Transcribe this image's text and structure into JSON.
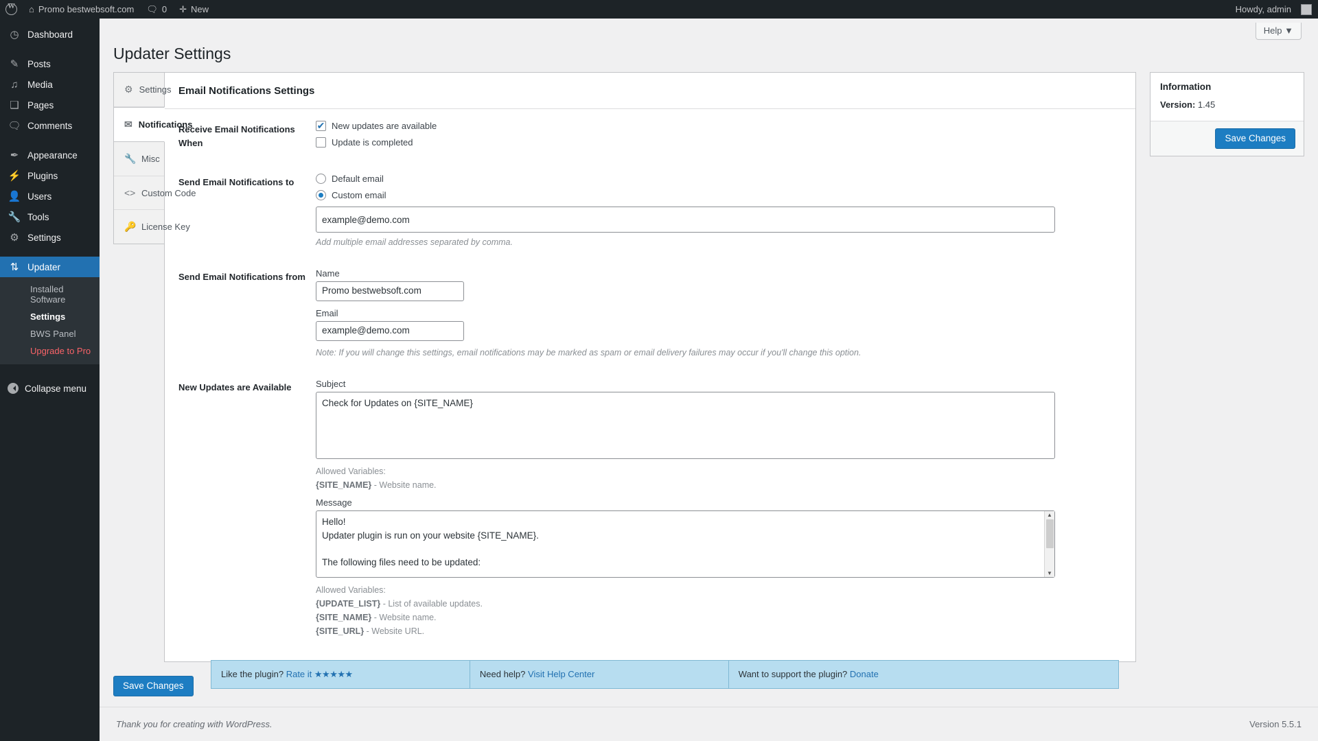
{
  "adminbar": {
    "logo_icon": "wordpress-logo-icon",
    "site_name": "Promo bestwebsoft.com",
    "home_icon": "home-icon",
    "comments_icon": "comment-bubble-icon",
    "comments_count": "0",
    "new_icon": "plus-icon",
    "new_label": "New",
    "howdy": "Howdy, admin"
  },
  "sidebar": {
    "items": [
      {
        "label": "Dashboard",
        "icon": "dashboard-icon"
      },
      {
        "label": "Posts",
        "icon": "pin-icon"
      },
      {
        "label": "Media",
        "icon": "media-icon"
      },
      {
        "label": "Pages",
        "icon": "pages-icon"
      },
      {
        "label": "Comments",
        "icon": "comment-bubble-icon"
      },
      {
        "label": "Appearance",
        "icon": "paintbrush-icon"
      },
      {
        "label": "Plugins",
        "icon": "plug-icon"
      },
      {
        "label": "Users",
        "icon": "user-icon"
      },
      {
        "label": "Tools",
        "icon": "wrench-icon"
      },
      {
        "label": "Settings",
        "icon": "sliders-icon"
      },
      {
        "label": "Updater",
        "icon": "update-arrows-icon"
      }
    ],
    "submenu": [
      {
        "label": "Installed Software",
        "state": "normal"
      },
      {
        "label": "Settings",
        "state": "active"
      },
      {
        "label": "BWS Panel",
        "state": "normal"
      },
      {
        "label": "Upgrade to Pro",
        "state": "pro"
      }
    ],
    "collapse_label": "Collapse menu",
    "collapse_icon": "collapse-arrow-icon"
  },
  "page": {
    "title": "Updater Settings",
    "help_label": "Help",
    "help_caret": "▼"
  },
  "tabs": [
    {
      "label": "Settings",
      "icon": "gear-icon",
      "active": false
    },
    {
      "label": "Notifications",
      "icon": "envelope-icon",
      "active": true
    },
    {
      "label": "Misc",
      "icon": "wrench-icon",
      "active": false
    },
    {
      "label": "Custom Code",
      "icon": "code-brackets-icon",
      "active": false
    },
    {
      "label": "License Key",
      "icon": "key-icon",
      "active": false
    }
  ],
  "panel": {
    "heading": "Email Notifications Settings",
    "receive_when": {
      "label": "Receive Email Notifications When",
      "options": [
        {
          "label": "New updates are available",
          "checked": true
        },
        {
          "label": "Update is completed",
          "checked": false
        }
      ]
    },
    "send_to": {
      "label": "Send Email Notifications to",
      "options": [
        {
          "label": "Default email",
          "selected": false
        },
        {
          "label": "Custom email",
          "selected": true
        }
      ],
      "custom_email_value": "example@demo.com",
      "hint": "Add multiple email addresses separated by comma."
    },
    "send_from": {
      "label": "Send Email Notifications from",
      "name_label": "Name",
      "name_value": "Promo bestwebsoft.com",
      "email_label": "Email",
      "email_value": "example@demo.com",
      "note": "Note: If you will change this settings, email notifications may be marked as spam or email delivery failures may occur if you'll change this option."
    },
    "new_updates": {
      "label": "New Updates are Available",
      "subject_label": "Subject",
      "subject_value": "Check for Updates on {SITE_NAME}",
      "subject_vars_title": "Allowed Variables:",
      "subject_vars": [
        {
          "name": "{SITE_NAME}",
          "desc": " - Website name."
        }
      ],
      "message_label": "Message",
      "message_value": "Hello!\nUpdater plugin is run on your website {SITE_NAME}.\n\nThe following files need to be updated:",
      "message_vars_title": "Allowed Variables:",
      "message_vars": [
        {
          "name": "{UPDATE_LIST}",
          "desc": " - List of available updates."
        },
        {
          "name": "{SITE_NAME}",
          "desc": " - Website name."
        },
        {
          "name": "{SITE_URL}",
          "desc": " - Website URL."
        }
      ]
    },
    "save_label": "Save Changes"
  },
  "information": {
    "heading": "Information",
    "version_label": "Version:",
    "version_value": "1.45",
    "save_label": "Save Changes"
  },
  "promo": [
    {
      "text": "Like the plugin?",
      "link": "Rate it",
      "stars": "★★★★★"
    },
    {
      "text": "Need help?",
      "link": "Visit Help Center",
      "stars": ""
    },
    {
      "text": "Want to support the plugin?",
      "link": "Donate",
      "stars": ""
    }
  ],
  "footer": {
    "thanks_prefix": "Thank you for creating with ",
    "thanks_link": "WordPress",
    "thanks_suffix": ".",
    "version": "Version 5.5.1"
  },
  "colors": {
    "accent": "#2271b1",
    "sidebar_bg": "#1d2327",
    "pro_red": "#f86368",
    "promo_bg": "#b7ddf0"
  }
}
